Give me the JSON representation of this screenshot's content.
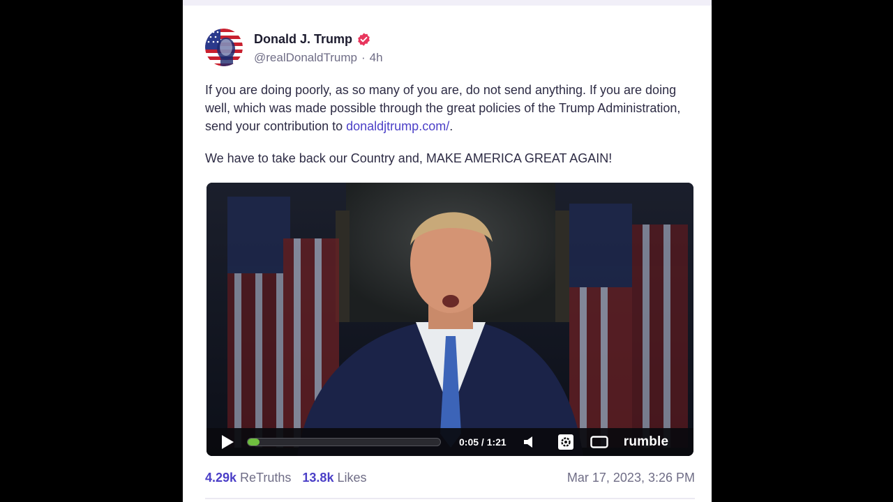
{
  "post": {
    "author": {
      "display_name": "Donald J. Trump",
      "handle": "@realDonaldTrump",
      "age": "4h",
      "separator": "·",
      "avatar_icon": "flag-portrait-avatar",
      "verified_icon": "verified-badge-icon",
      "verified_color": "#e8365d"
    },
    "body": {
      "paragraph1_text": "If you are doing poorly, as so many of you are, do not send anything. If you are doing well, which was made possible through the great policies of the Trump Administration, send your contribution to ",
      "link_text": "donaldjtrump.com/",
      "paragraph1_end": ".",
      "paragraph2": "We have to take back our Country and, MAKE AMERICA GREAT AGAIN!"
    },
    "video": {
      "time_display": "0:05 / 1:21",
      "progress": 0.06,
      "progress_color": "#6fbf3f",
      "brand": "rumble",
      "icons": [
        "play-icon",
        "volume-icon",
        "settings-gear-icon",
        "fullscreen-icon"
      ]
    },
    "stats": {
      "retruths_count": "4.29k",
      "retruths_label": "ReTruths",
      "likes_count": "13.8k",
      "likes_label": "Likes",
      "timestamp": "Mar 17, 2023, 3:26 PM"
    },
    "colors": {
      "accent": "#4b3fc7",
      "text": "#2d2b44",
      "muted": "#6f6d86"
    }
  }
}
